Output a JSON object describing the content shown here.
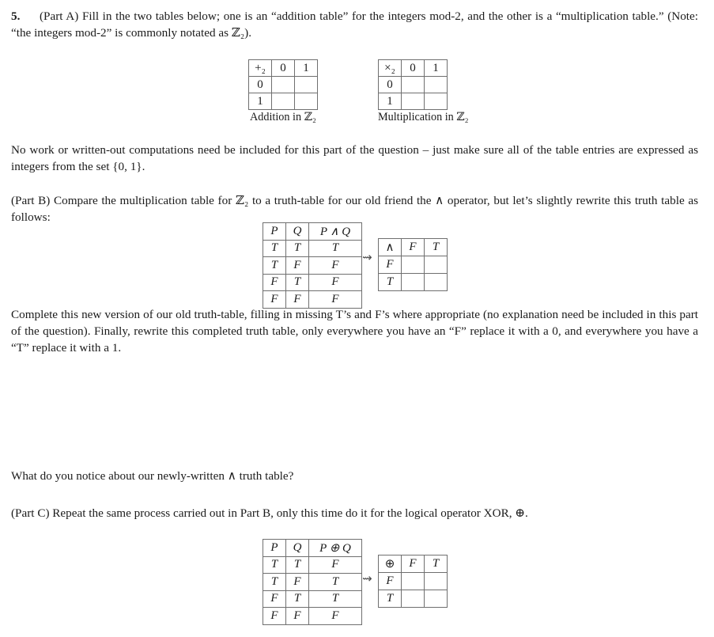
{
  "document": {
    "question_number": "5.",
    "part_a_text": "(Part A) Fill in the two tables below; one is an “addition table” for the integers mod-2, and the other is a “multiplication table.” (Note: “the integers mod-2” is commonly notated as ℤ₂).",
    "no_work_text": "No work or written-out computations need be included for this part of the question – just make sure all of the table entries are expressed as integers from the set {0, 1}.",
    "part_b_text": "(Part B) Compare the multiplication table for ℤ₂ to a truth-table for our old friend the ∧ operator, but let’s slightly rewrite this truth table as follows:",
    "complete_text": "Complete this new version of our old truth-table, filling in missing T’s and F’s where appropriate (no explanation need be included in this part of the question). Finally, rewrite this completed truth table, only everywhere you have an “F” replace it with a 0, and everywhere you have a “T” replace it with a 1.",
    "notice_text": "What do you notice about our newly-written ∧ truth table?",
    "part_c_text": "(Part C) Repeat the same process carried out in Part B, only this time do it for the logical operator XOR, ⊕."
  },
  "tables": {
    "addition_mod2": {
      "caption": "Addition in ℤ₂",
      "operator_symbol": "+₂",
      "col_headers": [
        "0",
        "1"
      ],
      "row_headers": [
        "0",
        "1"
      ],
      "cells": [
        [
          "",
          ""
        ],
        [
          "",
          ""
        ]
      ]
    },
    "multiplication_mod2": {
      "caption": "Multiplication in ℤ₂",
      "operator_symbol": "×₂",
      "col_headers": [
        "0",
        "1"
      ],
      "row_headers": [
        "0",
        "1"
      ],
      "cells": [
        [
          "",
          ""
        ],
        [
          "",
          ""
        ]
      ]
    },
    "and_truth_table": {
      "headers": [
        "P",
        "Q",
        "P ∧ Q"
      ],
      "rows": [
        [
          "T",
          "T",
          "T"
        ],
        [
          "T",
          "F",
          "F"
        ],
        [
          "F",
          "T",
          "F"
        ],
        [
          "F",
          "F",
          "F"
        ]
      ]
    },
    "and_op_table": {
      "operator_symbol": "∧",
      "col_headers": [
        "F",
        "T"
      ],
      "row_headers": [
        "F",
        "T"
      ],
      "cells": [
        [
          "",
          ""
        ],
        [
          "",
          ""
        ]
      ]
    },
    "xor_truth_table": {
      "headers": [
        "P",
        "Q",
        "P ⊕ Q"
      ],
      "rows": [
        [
          "T",
          "T",
          "F"
        ],
        [
          "T",
          "F",
          "T"
        ],
        [
          "F",
          "T",
          "T"
        ],
        [
          "F",
          "F",
          "F"
        ]
      ]
    },
    "xor_op_table": {
      "operator_symbol": "⊕",
      "col_headers": [
        "F",
        "T"
      ],
      "row_headers": [
        "F",
        "T"
      ],
      "cells": [
        [
          "",
          ""
        ],
        [
          "",
          ""
        ]
      ]
    },
    "arrow_symbol": "⇝"
  }
}
